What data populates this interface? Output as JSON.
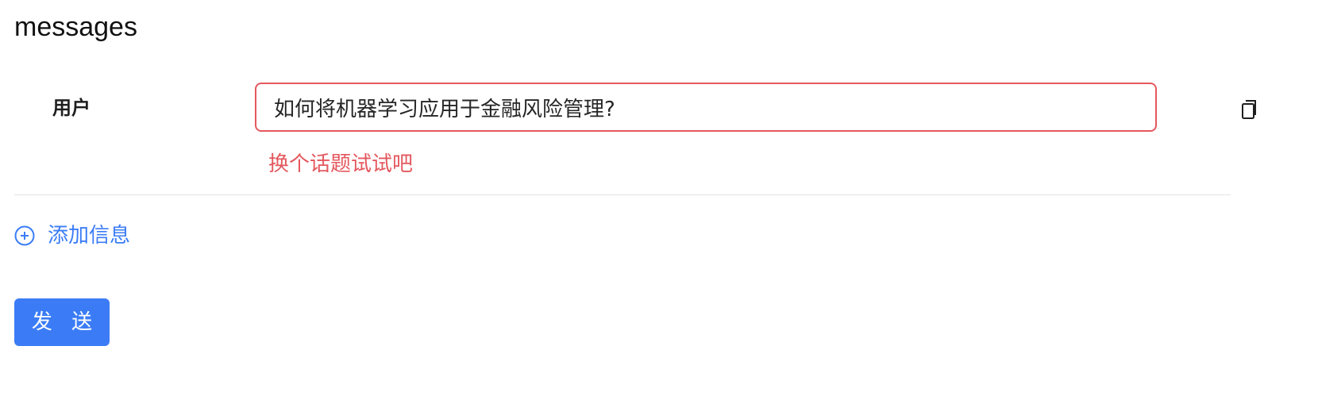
{
  "section": {
    "title": "messages"
  },
  "messages": [
    {
      "role_label": "用户",
      "content": "如何将机器学习应用于金融风险管理?",
      "error": "换个话题试试吧"
    }
  ],
  "icons": {
    "copy": "copy-icon",
    "add": "plus-circle-icon"
  },
  "actions": {
    "add_label": "添加信息",
    "send_label": "发 送"
  },
  "colors": {
    "accent": "#3b7cf6",
    "error": "#e4585e",
    "divider": "#e3e3e3"
  }
}
